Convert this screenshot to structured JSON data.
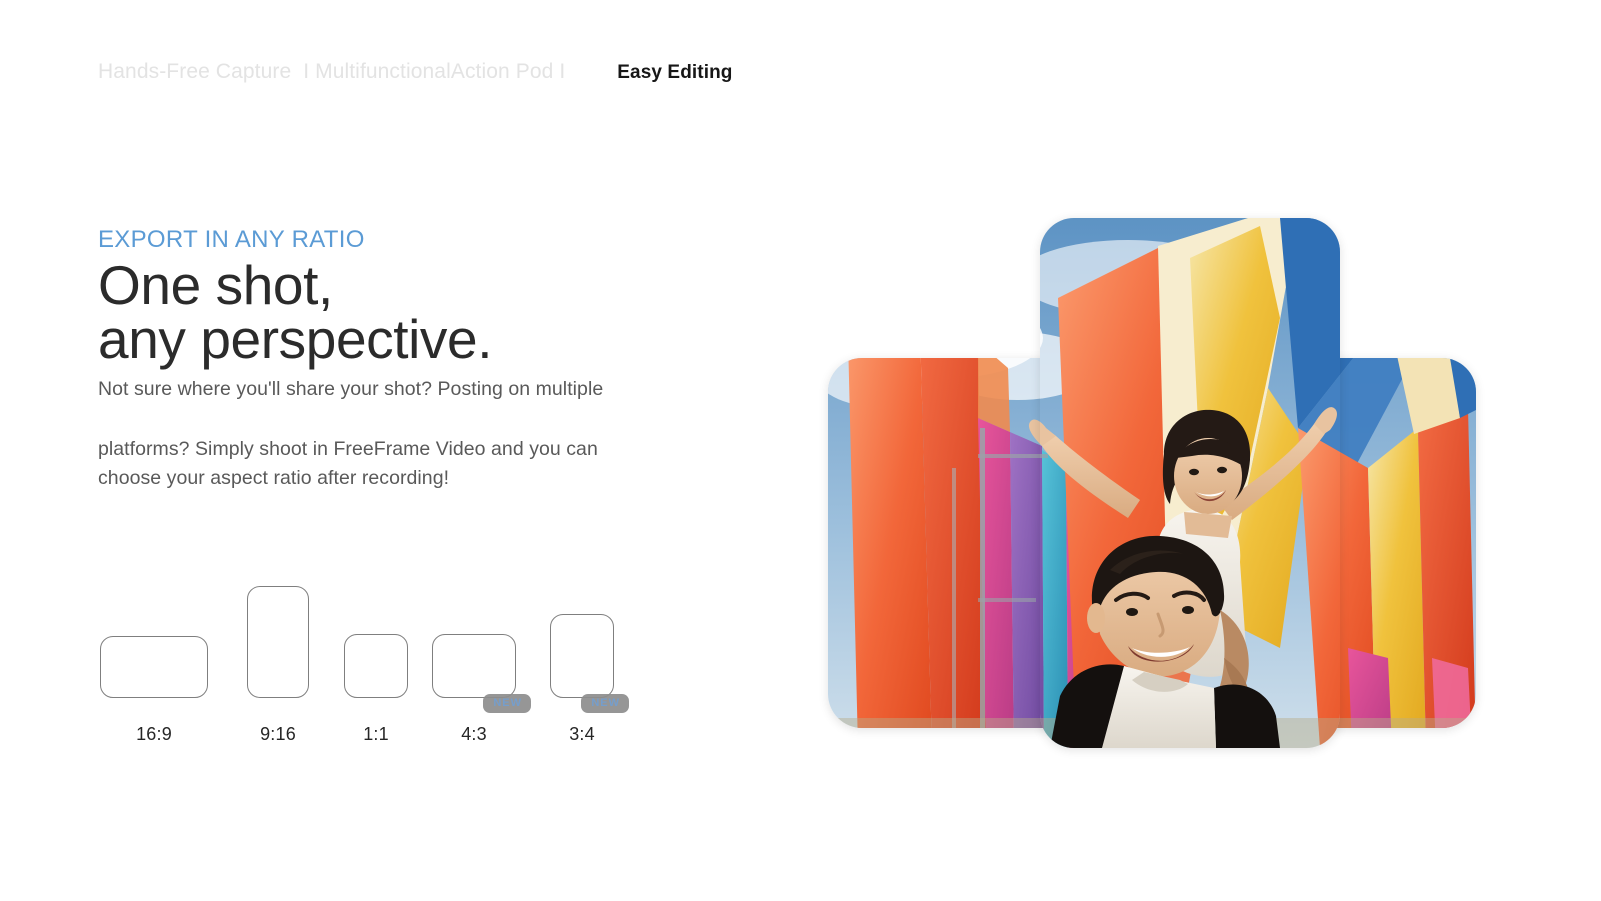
{
  "breadcrumb": {
    "items": [
      {
        "label": "Hands-Free Capture",
        "state": "muted"
      },
      {
        "label": "I MultifunctionalAction Pod I",
        "state": "muted"
      },
      {
        "label": "Easy Editing",
        "state": "active"
      }
    ],
    "muted_1": "Hands-Free Capture",
    "muted_2": "I MultifunctionalAction Pod I",
    "active": "Easy Editing"
  },
  "left": {
    "eyebrow": "EXPORT IN ANY RATIO",
    "headline_line1": "One shot,",
    "headline_line2": "any perspective.",
    "body_line1": "Not sure where you'll share your shot? Posting on multiple",
    "body_line2": "platforms? Simply shoot in FreeFrame Video and you can",
    "body_line3": "choose your aspect ratio after recording!"
  },
  "ratios": [
    {
      "label": "16:9",
      "badge": ""
    },
    {
      "label": "9:16",
      "badge": ""
    },
    {
      "label": "1:1",
      "badge": ""
    },
    {
      "label": "4:3",
      "badge": "NEW"
    },
    {
      "label": "3:4",
      "badge": "NEW"
    }
  ],
  "photo": {
    "alt": "Man carrying a smiling child on his shoulders with arms outstretched among tall colorful festival banners against a blue sky",
    "tiles": [
      {
        "name": "portrait-crop",
        "ratio": "9:16"
      },
      {
        "name": "landscape-crop",
        "ratio": "16:9"
      }
    ]
  },
  "colors": {
    "accent_blue": "#5b9bd5",
    "headline": "#2b2b2b",
    "body_text": "#595959",
    "muted_crumb": "#e3e3e3",
    "badge_bg": "#8e8e8e",
    "frame_stroke": "#7f7f7f",
    "page_bg": "#ffffff"
  }
}
